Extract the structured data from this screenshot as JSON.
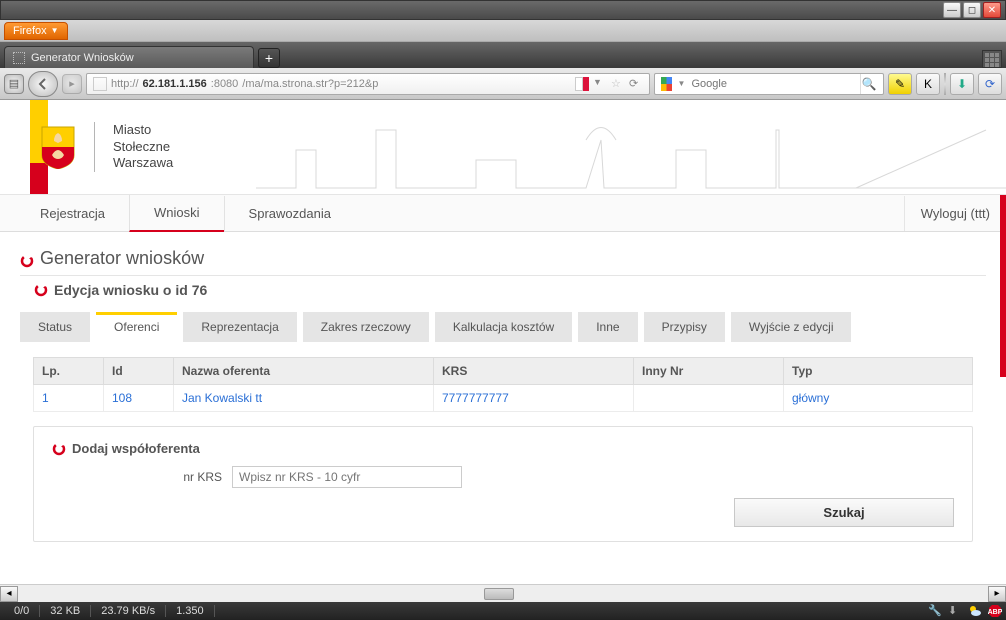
{
  "window": {
    "firefox_label": "Firefox"
  },
  "tab": {
    "title": "Generator Wniosków"
  },
  "addressbar": {
    "url_prefix": "http://",
    "url_host": "62.181.1.156",
    "url_port": ":8080",
    "url_path": "/ma/ma.strona.str?p=212&p",
    "search_placeholder": "Google"
  },
  "toolbar_icons": {
    "k_label": "K"
  },
  "site_header": {
    "city_line1": "Miasto",
    "city_line2": "Stołeczne",
    "city_line3": "Warszawa"
  },
  "topnav": {
    "items": [
      "Rejestracja",
      "Wnioski",
      "Sprawozdania"
    ],
    "active_index": 1,
    "logout": "Wyloguj (ttt)"
  },
  "page": {
    "title": "Generator wniosków",
    "subtitle": "Edycja wniosku o id 76"
  },
  "subtabs": {
    "items": [
      "Status",
      "Oferenci",
      "Reprezentacja",
      "Zakres rzeczowy",
      "Kalkulacja kosztów",
      "Inne",
      "Przypisy",
      "Wyjście z edycji"
    ],
    "active_index": 1
  },
  "table": {
    "headers": [
      "Lp.",
      "Id",
      "Nazwa oferenta",
      "KRS",
      "Inny Nr",
      "Typ"
    ],
    "rows": [
      {
        "lp": "1",
        "id": "108",
        "nazwa": "Jan Kowalski tt",
        "krs": "7777777777",
        "inny": "",
        "typ": "główny"
      }
    ]
  },
  "form": {
    "panel_title": "Dodaj współoferenta",
    "krs_label": "nr KRS",
    "krs_placeholder": "Wpisz nr KRS - 10 cyfr",
    "search_button": "Szukaj"
  },
  "statusbar": {
    "c1": "0/0",
    "c2": "32 KB",
    "c3": "23.79 KB/s",
    "c4": "1.350"
  }
}
